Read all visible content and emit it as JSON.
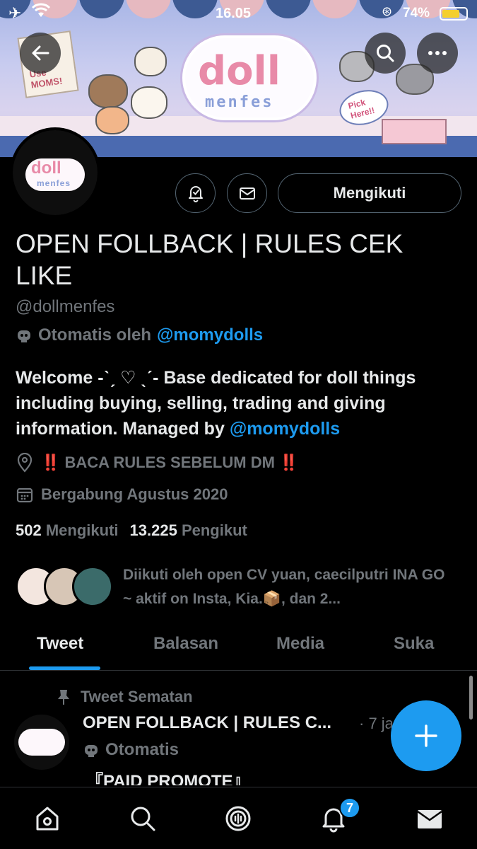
{
  "status_bar": {
    "time": "16.05",
    "battery_percent": "74%",
    "battery_level": 0.74
  },
  "banner": {
    "sign_text": "Use MOMS!",
    "logo_line1": "doll",
    "logo_line2": "menfes",
    "pick_text": "Pick Here!!"
  },
  "avatar": {
    "logo_line1": "doll",
    "logo_line2": "menfes"
  },
  "actions": {
    "follow_label": "Mengikuti"
  },
  "profile": {
    "display_name": "OPEN FOLLBACK | RULES CEK LIKE",
    "handle": "@dollmenfes",
    "automated_prefix": "Otomatis oleh",
    "automated_by": "@momydolls",
    "bio_text": "Welcome -ˋˏ ♡ ˎˊ- Base dedicated for doll things including buying, selling, trading and giving information. Managed by",
    "bio_mention": "@momydolls",
    "location": "‼️ BACA RULES SEBELUM DM ‼️",
    "joined": "Bergabung Agustus 2020",
    "following_count": "502",
    "following_label": "Mengikuti",
    "followers_count": "13.225",
    "followers_label": "Pengikut",
    "followed_by": "Diikuti oleh open CV yuan, caecilputri INA GO ~ aktif on Insta, Kia.📦, dan 2..."
  },
  "tabs": [
    "Tweet",
    "Balasan",
    "Media",
    "Suka"
  ],
  "active_tab": "Tweet",
  "pinned_tweet": {
    "pinned_label": "Tweet Sematan",
    "author": "OPEN FOLLBACK | RULES C...",
    "time": "· 7 ja",
    "automated_label": "Otomatis",
    "body": "『PAID PROMOTE』"
  },
  "bottom_nav": {
    "notifications_badge": "7"
  },
  "colors": {
    "accent": "#1d9bf0",
    "background": "#000000",
    "secondary_text": "#71767b"
  }
}
